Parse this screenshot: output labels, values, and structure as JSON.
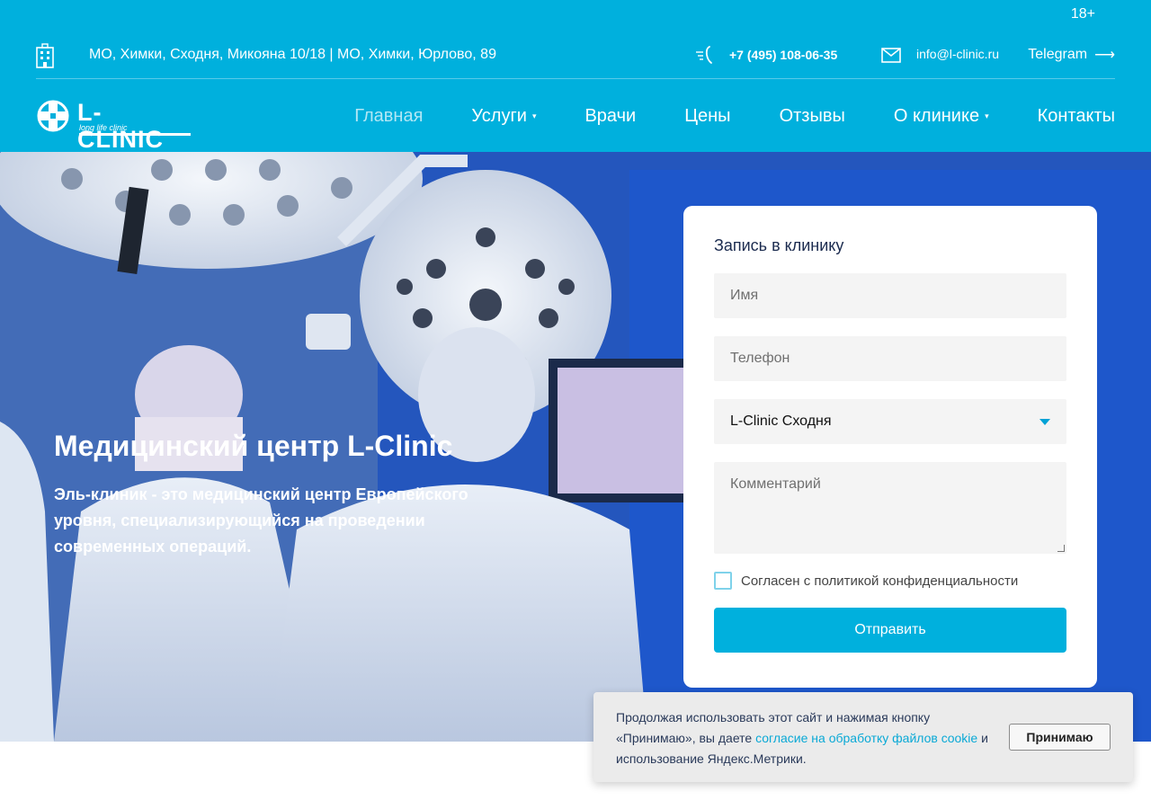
{
  "header": {
    "age_label": "18+",
    "address": "МО, Химки, Сходня, Микояна 10/18 | МО, Химки, Юрлово, 89",
    "phone": "+7 (495) 108-06-35",
    "email": "info@l-clinic.ru",
    "telegram": "Telegram",
    "telegram_arrow": "⟶",
    "brand_color": "#00b0dd"
  },
  "logo": {
    "name": "L-CLINIC",
    "tagline": "long life clinic"
  },
  "nav": {
    "items": [
      {
        "label": "Главная",
        "has_dropdown": false,
        "active": true
      },
      {
        "label": "Услуги",
        "has_dropdown": true
      },
      {
        "label": "Врачи",
        "has_dropdown": false
      },
      {
        "label": "Цены",
        "has_dropdown": false
      },
      {
        "label": "Отзывы",
        "has_dropdown": false
      },
      {
        "label": "О клинике",
        "has_dropdown": true
      },
      {
        "label": "Контакты",
        "has_dropdown": false
      }
    ],
    "caret": "▾"
  },
  "hero": {
    "title": "Медицинский центр L-Clinic",
    "text": "Эль-клиник - это медицинский центр Европейского уровня, специализирующийся на проведении современных операций."
  },
  "form": {
    "title": "Запись в клинику",
    "name_placeholder": "Имя",
    "phone_placeholder": "Телефон",
    "clinic_selected": "L-Clinic Сходня",
    "comment_placeholder": "Комментарий",
    "agree_label": "Согласен с политикой конфиденциальности",
    "agree_checked": false,
    "submit_label": "Отправить"
  },
  "cookie": {
    "text_before": "Продолжая использовать этот сайт и нажимая кнопку «Принимаю», вы даете ",
    "link_text": "согласие на обработку файлов cookie",
    "text_after": " и использование Яндекс.Метрики.",
    "accept_label": "Принимаю"
  }
}
